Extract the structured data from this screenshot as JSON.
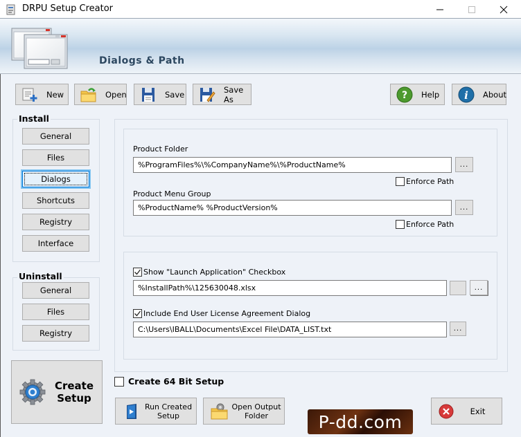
{
  "window": {
    "title": "DRPU Setup Creator",
    "controls": {
      "minimize": "—",
      "maximize": "☐",
      "close": "✕"
    }
  },
  "header": {
    "title": "Dialogs & Path",
    "icon": "dialog-windows-icon"
  },
  "toolbar": {
    "new_label": "New",
    "open_label": "Open",
    "save_label": "Save",
    "save_as_label": "Save As",
    "help_label": "Help",
    "about_label": "About"
  },
  "sidebar": {
    "install": {
      "title": "Install",
      "items": [
        {
          "label": "General",
          "active": false
        },
        {
          "label": "Files",
          "active": false
        },
        {
          "label": "Dialogs",
          "active": true
        },
        {
          "label": "Shortcuts",
          "active": false
        },
        {
          "label": "Registry",
          "active": false
        },
        {
          "label": "Interface",
          "active": false
        }
      ]
    },
    "uninstall": {
      "title": "Uninstall",
      "items": [
        {
          "label": "General"
        },
        {
          "label": "Files"
        },
        {
          "label": "Registry"
        }
      ]
    },
    "create_setup_label_line1": "Create",
    "create_setup_label_line2": "Setup"
  },
  "paths": {
    "product_folder_label": "Product Folder",
    "product_folder_value": "%ProgramFiles%\\%CompanyName%\\%ProductName%",
    "product_folder_enforce_label": "Enforce Path",
    "product_folder_enforce_checked": false,
    "menu_group_label": "Product Menu Group",
    "menu_group_value": "%ProductName% %ProductVersion%",
    "menu_group_enforce_label": "Enforce Path",
    "menu_group_enforce_checked": false,
    "browse_label": "..."
  },
  "options": {
    "launch_app_label": "Show \"Launch Application\" Checkbox",
    "launch_app_checked": true,
    "launch_app_value": "%InstallPath%\\125630048.xlsx",
    "eula_label": "Include End User License Agreement Dialog",
    "eula_checked": true,
    "eula_value": "C:\\Users\\IBALL\\Documents\\Excel File\\DATA_LIST.txt",
    "browse_label": "..."
  },
  "bottom": {
    "create64_label": "Create 64 Bit Setup",
    "create64_checked": false,
    "run_created_line1": "Run Created",
    "run_created_line2": "Setup",
    "open_output_line1": "Open Output",
    "open_output_line2": "Folder",
    "exit_label": "Exit",
    "watermark": "P-dd.com"
  }
}
